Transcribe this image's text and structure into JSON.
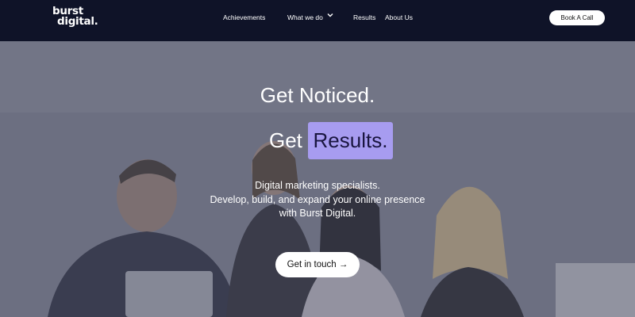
{
  "header": {
    "logo_line1": "burst",
    "logo_line2": "digital.",
    "nav": [
      {
        "label": "Achievements"
      },
      {
        "label": "What we do"
      },
      {
        "label": "Results"
      },
      {
        "label": "About Us"
      }
    ],
    "cta_label": "Book A Call"
  },
  "hero": {
    "headline1": "Get Noticed.",
    "headline2_prefix": "Get",
    "headline2_highlight": "Results.",
    "sub_line1": "Digital marketing specialists.",
    "sub_line2": "Develop, build, and expand your online presence",
    "sub_line3": "with Burst Digital.",
    "cta_label": "Get in touch →"
  },
  "colors": {
    "navy": "#0f1328",
    "accent_purple": "#a79cf0",
    "white": "#ffffff"
  },
  "icons": {
    "nav_dropdown": "chevron-down-icon"
  }
}
